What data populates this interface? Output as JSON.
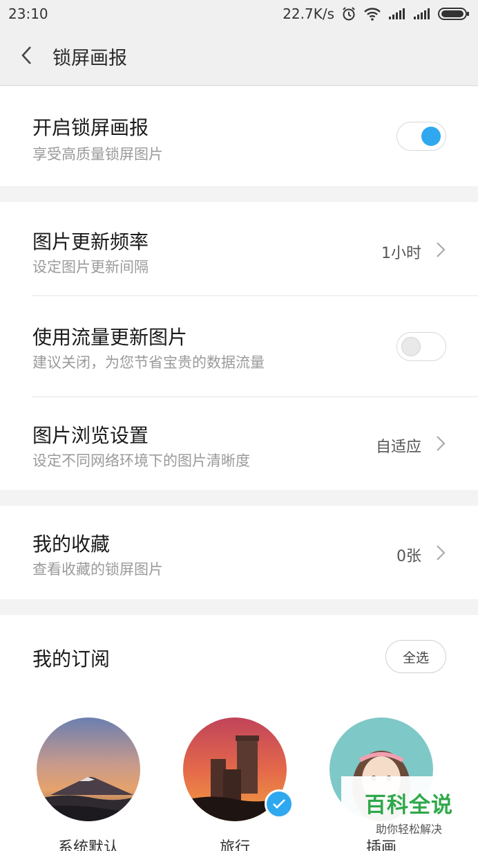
{
  "status_bar": {
    "time": "23:10",
    "speed": "22.7K/s",
    "icons": [
      "alarm-icon",
      "wifi-icon",
      "signal-icon",
      "signal-icon",
      "battery-icon"
    ]
  },
  "header": {
    "title": "锁屏画报",
    "back_icon": "back-arrow-icon"
  },
  "section1": {
    "enable": {
      "title": "开启锁屏画报",
      "subtitle": "享受高质量锁屏图片",
      "toggle_on": true
    }
  },
  "section2": {
    "frequency": {
      "title": "图片更新频率",
      "subtitle": "设定图片更新间隔",
      "value": "1小时"
    },
    "mobile_data": {
      "title": "使用流量更新图片",
      "subtitle": "建议关闭，为您节省宝贵的数据流量",
      "toggle_on": false
    },
    "browse": {
      "title": "图片浏览设置",
      "subtitle": "设定不同网络环境下的图片清晰度",
      "value": "自适应"
    }
  },
  "section3": {
    "favorites": {
      "title": "我的收藏",
      "subtitle": "查看收藏的锁屏图片",
      "value": "0张"
    }
  },
  "subscriptions": {
    "title": "我的订阅",
    "select_all": "全选",
    "items": [
      {
        "label": "系统默认",
        "selected": false
      },
      {
        "label": "旅行",
        "selected": true
      },
      {
        "label": "插画",
        "selected": false
      }
    ]
  },
  "watermark": {
    "title": "百科全说",
    "subtitle": "助你轻松解决"
  },
  "colors": {
    "accent": "#2fa8f0",
    "watermark_green": "#2fa84a"
  }
}
